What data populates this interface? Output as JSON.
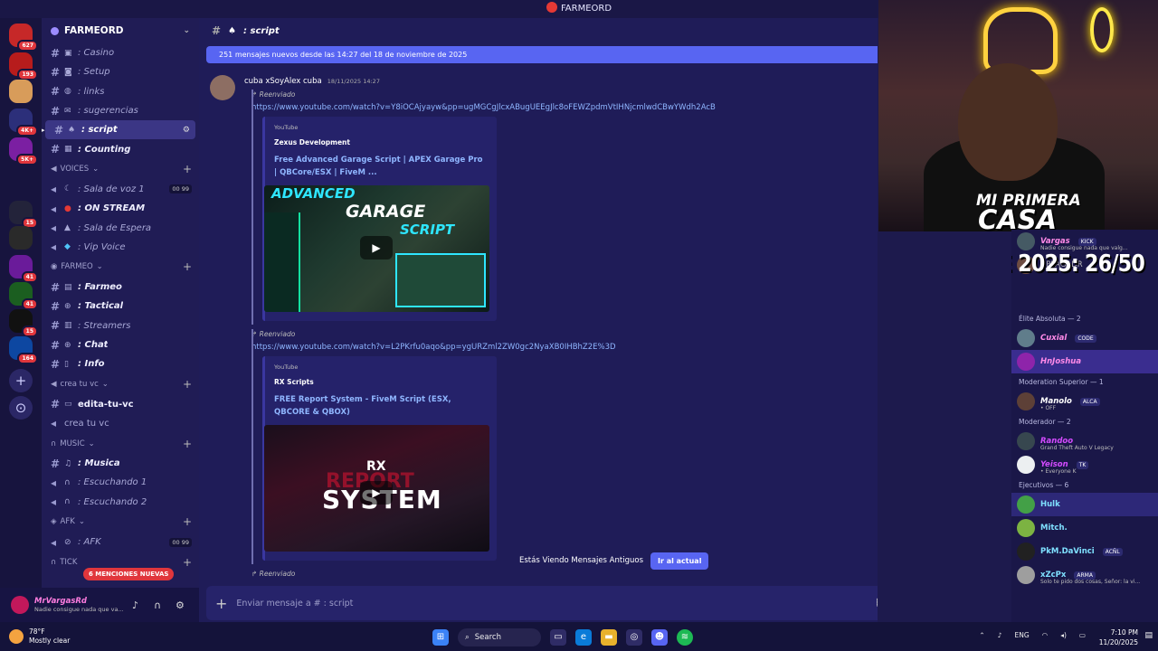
{
  "window": {
    "title": "FARMEORD"
  },
  "servers": {
    "badges": [
      "627",
      "193",
      "4K+",
      "5K+",
      "15",
      "41",
      "41",
      "15",
      "164"
    ]
  },
  "guild": {
    "name": "FARMEORD"
  },
  "channels": {
    "top": [
      {
        "label": ": Casino"
      },
      {
        "label": ": Setup"
      },
      {
        "label": ": links"
      },
      {
        "label": ": sugerencias"
      },
      {
        "label": ": script"
      },
      {
        "label": ": Counting"
      }
    ],
    "voices_cat": "VOICES",
    "voices": [
      {
        "label": ": Sala de voz 1",
        "count": "00 99"
      },
      {
        "label": ": ON STREAM"
      },
      {
        "label": ": Sala de Espera"
      },
      {
        "label": ": Vip Voice"
      }
    ],
    "farmeo_cat": "FARMEO",
    "farmeo": [
      {
        "label": ": Farmeo"
      },
      {
        "label": ": Tactical"
      },
      {
        "label": ": Streamers"
      },
      {
        "label": ": Chat"
      },
      {
        "label": ": Info"
      }
    ],
    "crea_cat": "crea tu vc",
    "crea": [
      {
        "label": "edita-tu-vc"
      },
      {
        "label": "crea tu vc"
      }
    ],
    "music_cat": "MUSIC",
    "music": [
      {
        "label": ": Musica"
      },
      {
        "label": ": Escuchando 1"
      },
      {
        "label": ": Escuchando 2"
      }
    ],
    "afk_cat": "AFK",
    "afk": [
      {
        "label": ": AFK",
        "count": "00 99"
      }
    ],
    "tick_cat": "TICK",
    "mentions": "6 MENCIONES NUEVAS"
  },
  "user": {
    "name": "MrVargasRd",
    "status": "Nadie consigue nada que va..."
  },
  "chat": {
    "channel": ": script",
    "new_messages": "251 mensajes nuevos desde las 14:27 del 18 de noviembre de 2025",
    "author": "cuba xSoyAlex cuba",
    "time": "18/11/2025 14:27",
    "forwarded": "Reenviado",
    "link1": "https://www.youtube.com/watch?v=Y8iOCAjyayw&pp=ugMGCgJlcxABugUEEgJlc8oFEWZpdmVtIHNjcmlwdCBwYWdh2AcB",
    "embed1": {
      "provider": "YouTube",
      "author": "Zexus Development",
      "title": "Free Advanced Garage Script | APEX Garage Pro | QBCore/ESX | FiveM ...",
      "thumb_a": "ADVANCED",
      "thumb_b": "GARAGE",
      "thumb_c": "SCRIPT"
    },
    "link2": "https://www.youtube.com/watch?v=L2PKrfu0aqo&pp=ygURZml2ZW0gc2NyaXB0IHBhZ2E%3D",
    "embed2": {
      "provider": "YouTube",
      "author": "RX Scripts",
      "title": "FREE Report System - FiveM Script (ESX, QBCORE & QBOX)",
      "thumb_a": "RX",
      "thumb_b": "REPORT",
      "thumb_c": "SYSTEM"
    },
    "old_notice": "Estás Viendo Mensajes Antiguos",
    "go_current": "Ir al actual",
    "composer_placeholder": "Enviar mensaje a #  : script"
  },
  "stream": {
    "caption1": "MI PRIMERA",
    "caption2": "CASA",
    "overlay": "EXTENSIBLE 2025: 26/50"
  },
  "members": {
    "top": [
      {
        "name": "Vargas",
        "tag": "KICK",
        "sub": "Nadie consigue nada que valg..."
      },
      {
        "name": "! PLAGADR"
      }
    ],
    "groups": [
      {
        "label": "Élite Absoluta — 2",
        "items": [
          {
            "name": "Cuxial",
            "tag": "CODE"
          },
          {
            "name": "HnJoshua"
          }
        ]
      },
      {
        "label": "Moderation Superior — 1",
        "items": [
          {
            "name": "Manolo",
            "tag": "ALCA",
            "sub": "• OFF"
          }
        ]
      },
      {
        "label": "Moderador — 2",
        "items": [
          {
            "name": "Randoo",
            "sub": "Grand Theft Auto V Legacy"
          },
          {
            "name": "Yeison",
            "tag": "TK",
            "sub": "• Everyone K"
          }
        ]
      },
      {
        "label": "Ejecutivos — 6",
        "items": [
          {
            "name": "Hulk"
          },
          {
            "name": "Mitch."
          },
          {
            "name": "PkM.DaVinci",
            "tag": "ACÑL"
          },
          {
            "name": "xZcPx",
            "tag": "ARMA",
            "sub": "Solo te pido dos cosas, Señor: la vi..."
          }
        ]
      }
    ]
  },
  "taskbar": {
    "temp": "78°F",
    "weather": "Mostly clear",
    "search": "Search",
    "lang": "ENG",
    "time": "7:10 PM",
    "date": "11/20/2025"
  }
}
